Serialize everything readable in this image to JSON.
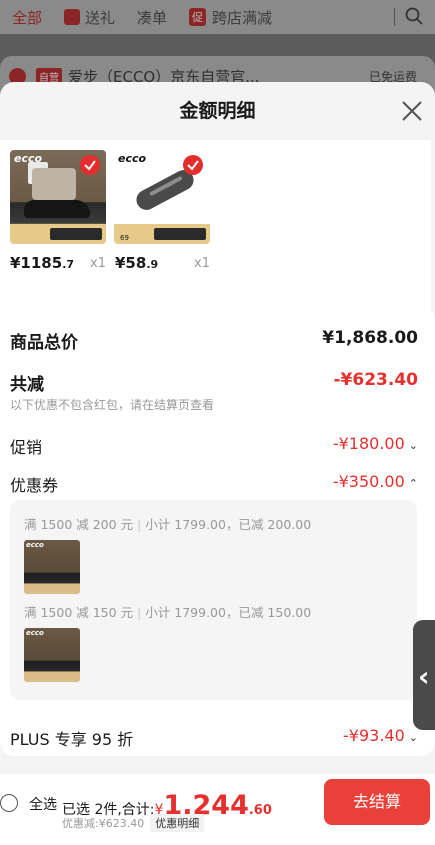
{
  "background": {
    "tabs": [
      "全部",
      "送礼",
      "凑单",
      "促",
      "跨店满减"
    ],
    "store_tag": "自营",
    "store_name": "爱步（ECCO）京东自营官...",
    "shipping": "已免运费"
  },
  "modal": {
    "title": "金额明细",
    "products": [
      {
        "brand": "ecco",
        "price_int": "¥1185",
        "price_dec": ".7",
        "qty": "x1"
      },
      {
        "brand": "ecco",
        "price_int": "¥58",
        "price_dec": ".9",
        "qty": "x1",
        "badge": "69"
      }
    ],
    "goods_total_label": "商品总价",
    "goods_total_value": "¥1,868.00",
    "discount_label": "共减",
    "discount_value": "-¥623.40",
    "discount_note": "以下优惠不包含红包，请在结算页查看",
    "promo_label": "促销",
    "promo_value": "-¥180.00",
    "coupon_label": "优惠券",
    "coupon_value": "-¥350.00",
    "coupons": [
      {
        "rule": "满 1500 减 200 元",
        "detail": "小计 1799.00，已减 200.00"
      },
      {
        "rule": "满 1500 减 150 元",
        "detail": "小计 1799.00，已减 150.00"
      }
    ],
    "plus_label": "PLUS 专享 95 折",
    "plus_value": "-¥93.40"
  },
  "bottom_bar": {
    "select_all": "全选",
    "selected_text": "已选 2件,合计:",
    "yen": "¥",
    "total_int": "1,244",
    "total_dec": ".60",
    "discount_note": "优惠减:¥623.40",
    "detail_link": "优惠明细",
    "checkout": "去结算"
  },
  "colors": {
    "accent": "#e6302d",
    "checkout_bg": "#e8413a"
  }
}
